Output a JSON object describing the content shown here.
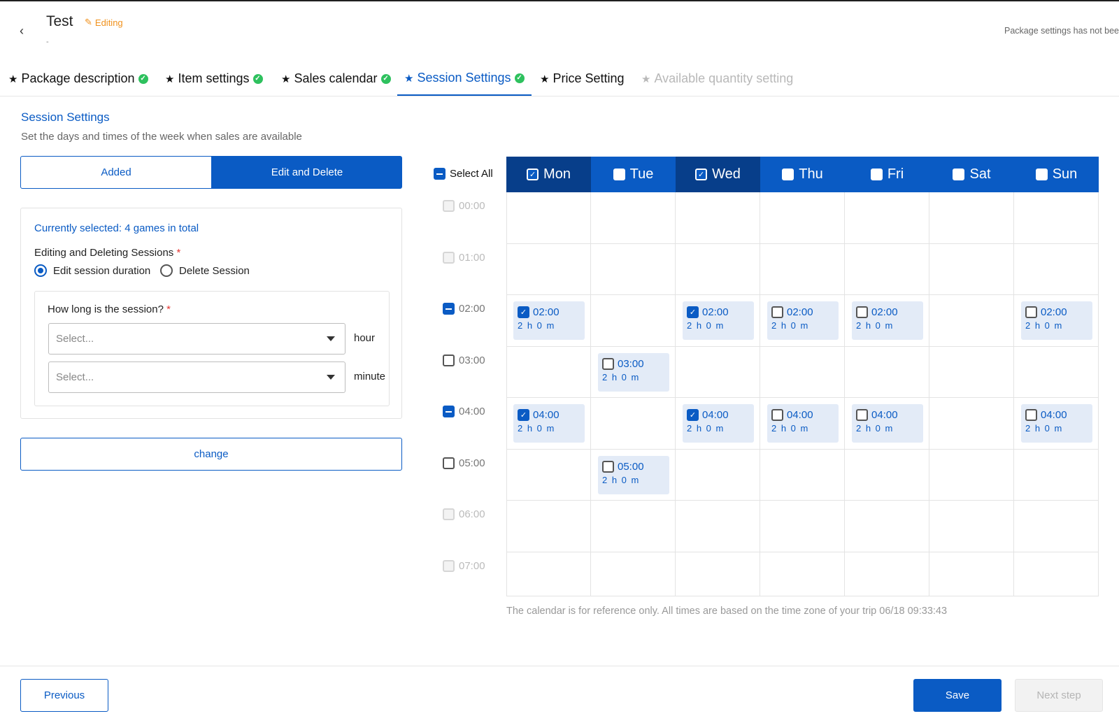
{
  "header": {
    "back_icon": "chevron-left-icon",
    "title": "Test",
    "status": "Editing",
    "subtitle": "-",
    "notice": "Package settings has not been"
  },
  "tabs": [
    {
      "label": "Package description",
      "done": true,
      "state": "normal"
    },
    {
      "label": "Item settings",
      "done": true,
      "state": "normal"
    },
    {
      "label": "Sales calendar",
      "done": true,
      "state": "normal"
    },
    {
      "label": "Session Settings",
      "done": true,
      "state": "active"
    },
    {
      "label": "Price Setting",
      "done": false,
      "state": "normal"
    },
    {
      "label": "Available quantity setting",
      "done": false,
      "state": "disabled"
    }
  ],
  "section": {
    "title": "Session Settings",
    "subtitle": "Set the days and times of the week when sales are available"
  },
  "mode": {
    "added": "Added",
    "edit_delete": "Edit and Delete",
    "selected": "edit_delete"
  },
  "panel": {
    "current": "Currently selected: 4 games in total",
    "editing_label": "Editing and Deleting Sessions",
    "required_mark": "*",
    "radio_edit": "Edit session duration",
    "radio_delete": "Delete Session",
    "selected_radio": "edit",
    "duration_label": "How long is the session?",
    "hour_placeholder": "Select...",
    "hour_unit": "hour",
    "minute_placeholder": "Select...",
    "minute_unit": "minute"
  },
  "change_label": "change",
  "calendar": {
    "select_all": "Select All",
    "days": [
      {
        "label": "Mon",
        "checked": true
      },
      {
        "label": "Tue",
        "checked": false
      },
      {
        "label": "Wed",
        "checked": true
      },
      {
        "label": "Thu",
        "checked": false
      },
      {
        "label": "Fri",
        "checked": false
      },
      {
        "label": "Sat",
        "checked": false
      },
      {
        "label": "Sun",
        "checked": false
      }
    ],
    "hours": [
      {
        "label": "00:00",
        "state": "disabled"
      },
      {
        "label": "01:00",
        "state": "disabled"
      },
      {
        "label": "02:00",
        "state": "indeterminate"
      },
      {
        "label": "03:00",
        "state": "unchecked"
      },
      {
        "label": "04:00",
        "state": "indeterminate"
      },
      {
        "label": "05:00",
        "state": "unchecked"
      },
      {
        "label": "06:00",
        "state": "disabled"
      },
      {
        "label": "07:00",
        "state": "disabled"
      }
    ],
    "sessions": [
      {
        "day": 0,
        "hour": 2,
        "time": "02:00",
        "duration": "2 h 0 m",
        "checked": true
      },
      {
        "day": 2,
        "hour": 2,
        "time": "02:00",
        "duration": "2 h 0 m",
        "checked": true
      },
      {
        "day": 3,
        "hour": 2,
        "time": "02:00",
        "duration": "2 h 0 m",
        "checked": false
      },
      {
        "day": 4,
        "hour": 2,
        "time": "02:00",
        "duration": "2 h 0 m",
        "checked": false
      },
      {
        "day": 6,
        "hour": 2,
        "time": "02:00",
        "duration": "2 h 0 m",
        "checked": false
      },
      {
        "day": 1,
        "hour": 3,
        "time": "03:00",
        "duration": "2 h 0 m",
        "checked": false
      },
      {
        "day": 0,
        "hour": 4,
        "time": "04:00",
        "duration": "2 h 0 m",
        "checked": true
      },
      {
        "day": 2,
        "hour": 4,
        "time": "04:00",
        "duration": "2 h 0 m",
        "checked": true
      },
      {
        "day": 3,
        "hour": 4,
        "time": "04:00",
        "duration": "2 h 0 m",
        "checked": false
      },
      {
        "day": 4,
        "hour": 4,
        "time": "04:00",
        "duration": "2 h 0 m",
        "checked": false
      },
      {
        "day": 6,
        "hour": 4,
        "time": "04:00",
        "duration": "2 h 0 m",
        "checked": false
      },
      {
        "day": 1,
        "hour": 5,
        "time": "05:00",
        "duration": "2 h 0 m",
        "checked": false
      }
    ],
    "note": "The calendar is for reference only. All times are based on the time zone of your trip  06/18 09:33:43"
  },
  "footer": {
    "previous": "Previous",
    "save": "Save",
    "next": "Next step"
  },
  "colors": {
    "primary": "#0a5bc4",
    "header_checked": "#073e8a",
    "success": "#2ec15e",
    "editing": "#f0921e",
    "slot_bg": "#e3ebf7"
  }
}
